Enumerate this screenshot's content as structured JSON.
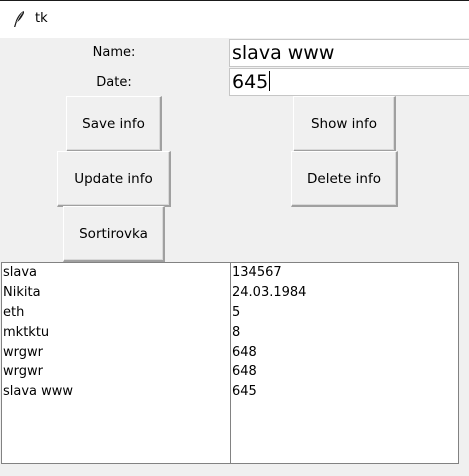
{
  "window": {
    "title": "tk"
  },
  "form": {
    "name_label": "Name:",
    "date_label": "Date:",
    "name_value": "slava www",
    "date_value": "645"
  },
  "buttons": {
    "save": "Save info",
    "show": "Show info",
    "update": "Update info",
    "delete": "Delete info",
    "sort": "Sortirovka"
  },
  "names_list": [
    "slava",
    "Nikita",
    "eth",
    "mktktu",
    "wrgwr",
    "wrgwr",
    "slava www"
  ],
  "dates_list": [
    "134567",
    "24.03.1984",
    "5",
    "8",
    "648",
    "648",
    "645"
  ]
}
